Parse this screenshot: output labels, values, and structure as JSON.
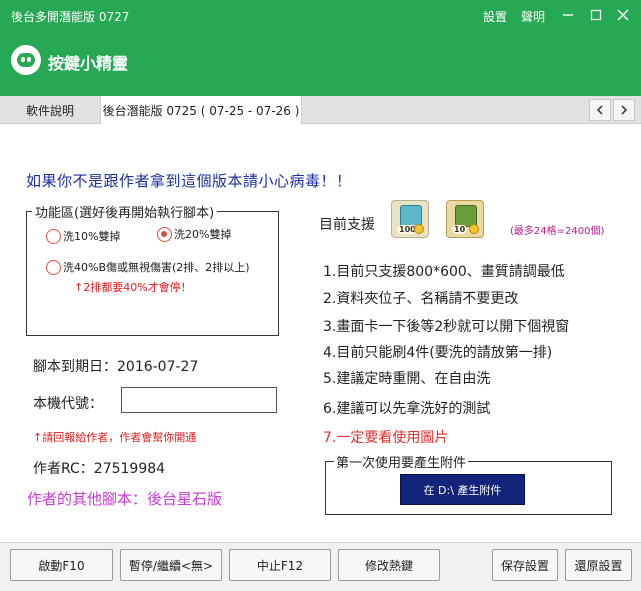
{
  "window": {
    "title": "後台多開潛能版 0727",
    "links": [
      "設置",
      "聲明"
    ],
    "app_title": "按鍵小精靈"
  },
  "tabs": [
    {
      "label": "軟件說明",
      "active": false
    },
    {
      "label": "後台潛能版 0725 ( 07-25 - 07-26 )",
      "active": true
    }
  ],
  "warning": "如果你不是跟作者拿到這個版本請小心病毒！！",
  "function_area": {
    "legend": "功能區(選好後再開始執行腳本)",
    "options": [
      {
        "label": "洗10%雙掉",
        "selected": false
      },
      {
        "label": "洗20%雙掉",
        "selected": true
      },
      {
        "label": "洗40%B傷或無視傷害(2排、2排以上)",
        "selected": false
      }
    ],
    "note": "↑2排都要40%才會停！"
  },
  "expiry": "腳本到期日：2016-07-27",
  "machine": {
    "label": "本機代號：",
    "value": ""
  },
  "report": "↑請回報給作者，作者會幫你開通",
  "author_rc": "作者RC：27519984",
  "other_scripts": "作者的其他腳本：後台星石版",
  "support": {
    "label": "目前支援",
    "items": [
      {
        "icon": "stone-cube-icon",
        "badge": "100"
      },
      {
        "icon": "gem-cube-icon",
        "badge": "10"
      }
    ],
    "max_note": "(最多24格=2400個)"
  },
  "rules": [
    "1.目前只支援800*600、畫質請調最低",
    "2.資料夾位子、名稱請不要更改",
    "3.畫面卡一下後等2秒就可以開下個視窗",
    "4.目前只能刷4件(要洗的請放第一排)",
    "5.建議定時重開、在自由洗",
    "6.建議可以先拿洗好的測試",
    "7.一定要看使用圖片"
  ],
  "generate": {
    "legend": "第一次使用要產生附件",
    "button": "在 D:\\ 產生附件"
  },
  "buttons": {
    "start": "啟動F10",
    "pause": "暫停/繼續<無>",
    "stop": "中止F12",
    "hotkey": "修改熱鍵",
    "save": "保存設置",
    "restore": "還原設置"
  },
  "colors": {
    "titlebar": "#27a855",
    "warning_text": "#1e2f9e",
    "alert_red": "#e02020",
    "purple_text": "#c83ad6",
    "generate_button": "#13247a"
  }
}
